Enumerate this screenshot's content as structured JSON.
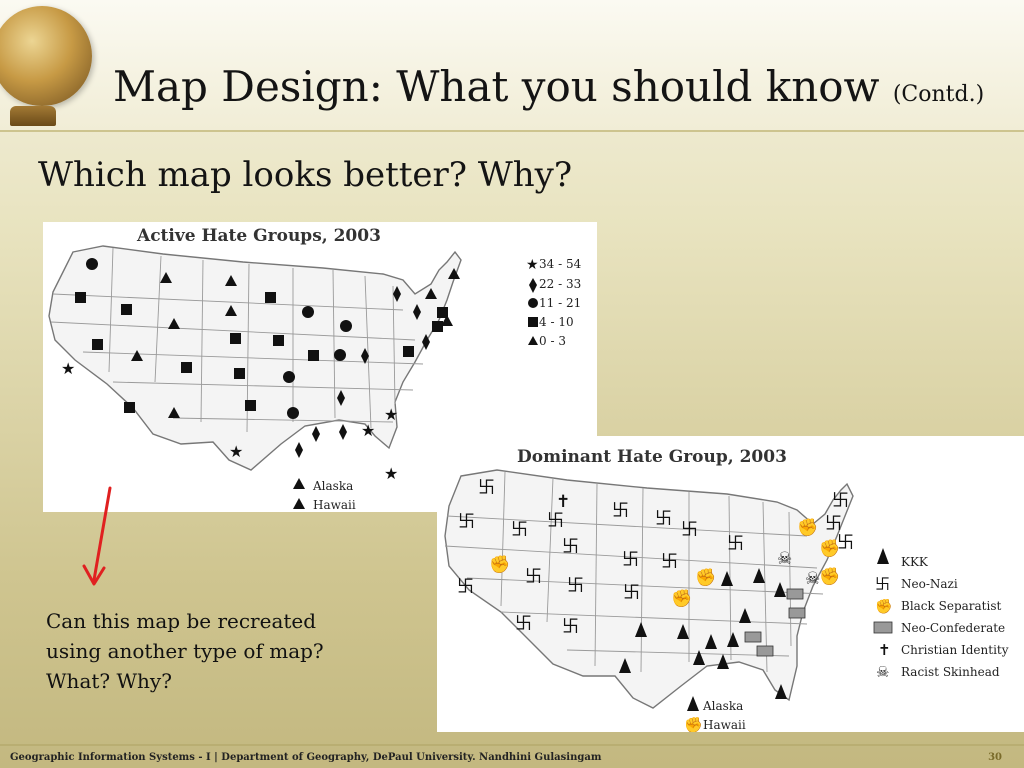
{
  "slide": {
    "title": "Map Design: What you should know",
    "title_suffix": "(Contd.)",
    "question": "Which map looks better? Why?",
    "caption_lines": [
      "Can this map be recreated",
      "using another type of map?",
      "What? Why?"
    ],
    "footer": "Geographic Information Systems - I | Department of Geography, DePaul University. Nandhini Gulasingam",
    "page_number": "30"
  },
  "map1": {
    "title": "Active Hate Groups, 2003",
    "legend": [
      {
        "symbol": "star",
        "label": "34 - 54"
      },
      {
        "symbol": "diamond",
        "label": "22 - 33"
      },
      {
        "symbol": "circle",
        "label": "11 - 21"
      },
      {
        "symbol": "square",
        "label": "4 - 10"
      },
      {
        "symbol": "triangle",
        "label": "0 - 3"
      }
    ],
    "inset_labels": [
      "Alaska",
      "Hawaii"
    ]
  },
  "map2": {
    "title": "Dominant Hate Group, 2003",
    "legend": [
      {
        "symbol": "hood-icon",
        "label": "KKK"
      },
      {
        "symbol": "swastika-icon",
        "label": "Neo-Nazi"
      },
      {
        "symbol": "fist-icon",
        "label": "Black Separatist"
      },
      {
        "symbol": "confederate-flag-icon",
        "label": "Neo-Confederate"
      },
      {
        "symbol": "cross-icon",
        "label": "Christian Identity"
      },
      {
        "symbol": "skull-icon",
        "label": "Racist Skinhead"
      }
    ],
    "inset_labels": [
      "Alaska",
      "Hawaii"
    ]
  },
  "colors": {
    "annotation_arrow": "#e02020",
    "map_border": "#888888",
    "symbol": "#111111"
  }
}
